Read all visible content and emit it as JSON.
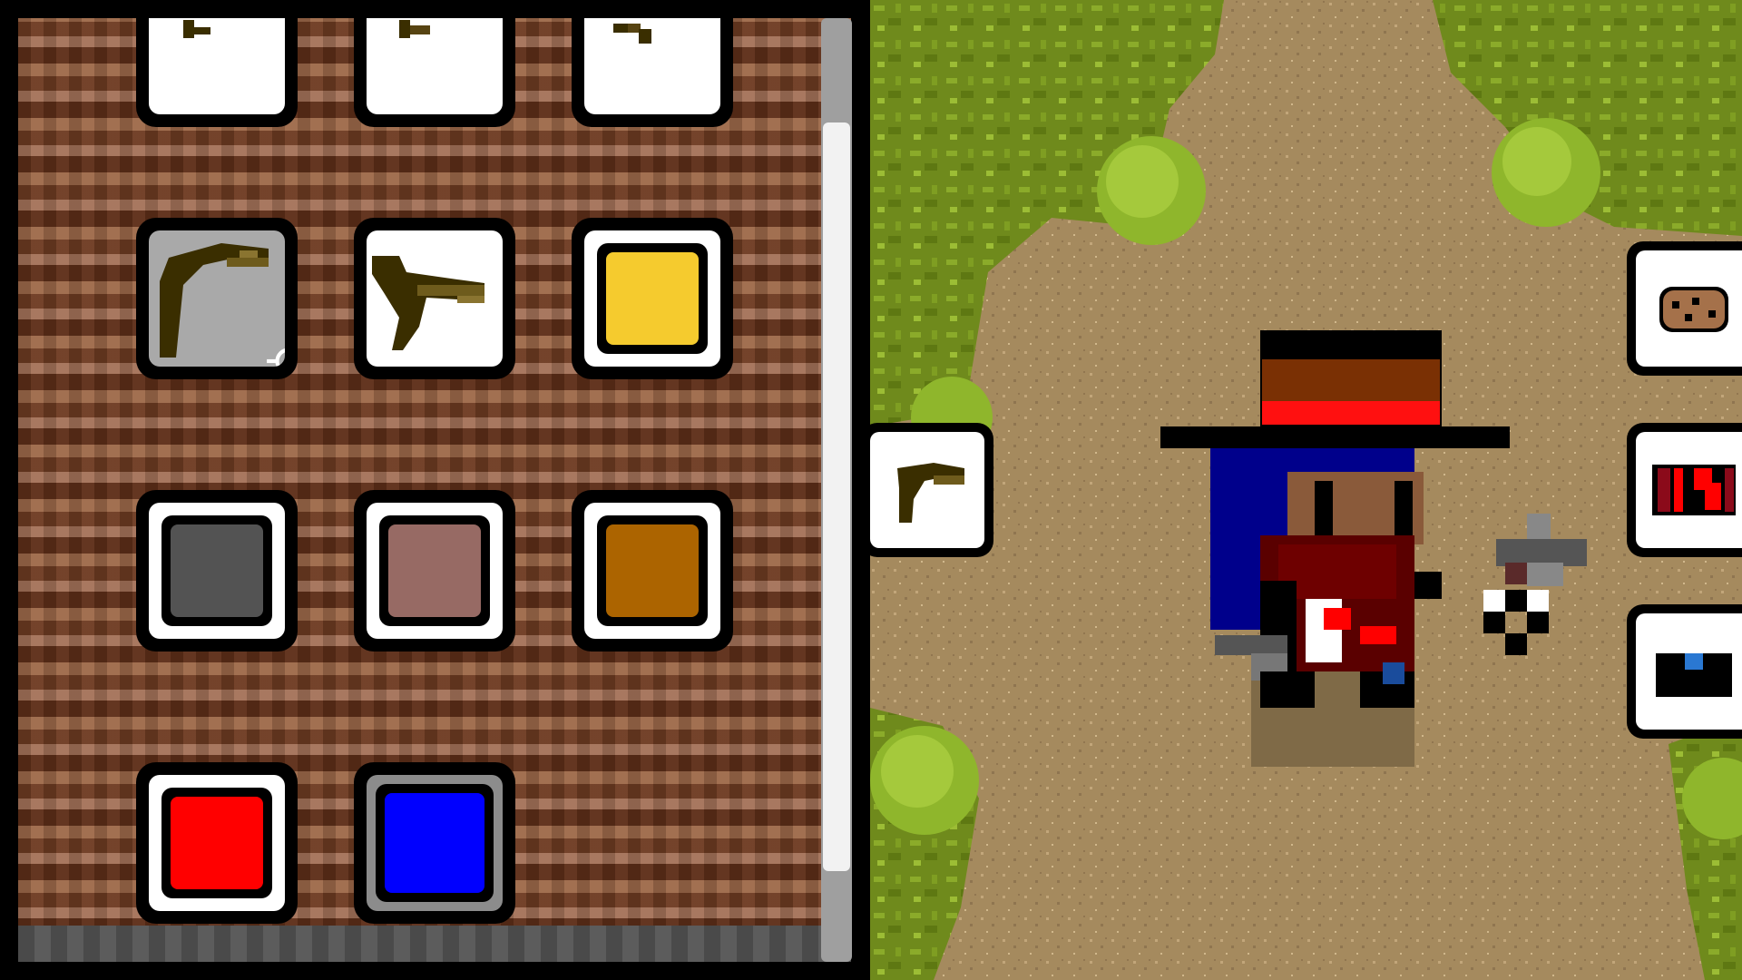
{
  "inventory": {
    "rows": [
      {
        "row": "top-partial",
        "slots": [
          {
            "item": "pickaxe-icon"
          },
          {
            "item": "hammer-icon"
          },
          {
            "item": "crossbow-icon"
          }
        ]
      },
      {
        "row": "tools",
        "slots": [
          {
            "item": "pickaxe-icon",
            "selected": true
          },
          {
            "item": "crossbow-icon"
          },
          {
            "item": "color-swatch",
            "color": "#f5cb2e"
          }
        ]
      },
      {
        "row": "colors-1",
        "slots": [
          {
            "item": "color-swatch",
            "color": "#535353"
          },
          {
            "item": "color-swatch",
            "color": "#976a64"
          },
          {
            "item": "color-swatch",
            "color": "#ac6400"
          }
        ]
      },
      {
        "row": "colors-2",
        "slots": [
          {
            "item": "color-swatch",
            "color": "#ff0000"
          },
          {
            "item": "color-swatch",
            "color": "#0000ff",
            "highlighted": true
          }
        ]
      }
    ]
  },
  "hud": {
    "left_slot": "pickaxe-icon",
    "right_slots": [
      "cookie-icon",
      "flag-icon",
      "blue-block-icon"
    ]
  },
  "colors": {
    "grass": "#6f8a1c",
    "dirt": "#a58a5e",
    "hat_brim": "#7a3004",
    "hat_band": "#ff1010",
    "hair": "#00008b",
    "shirt": "#6e0000"
  }
}
